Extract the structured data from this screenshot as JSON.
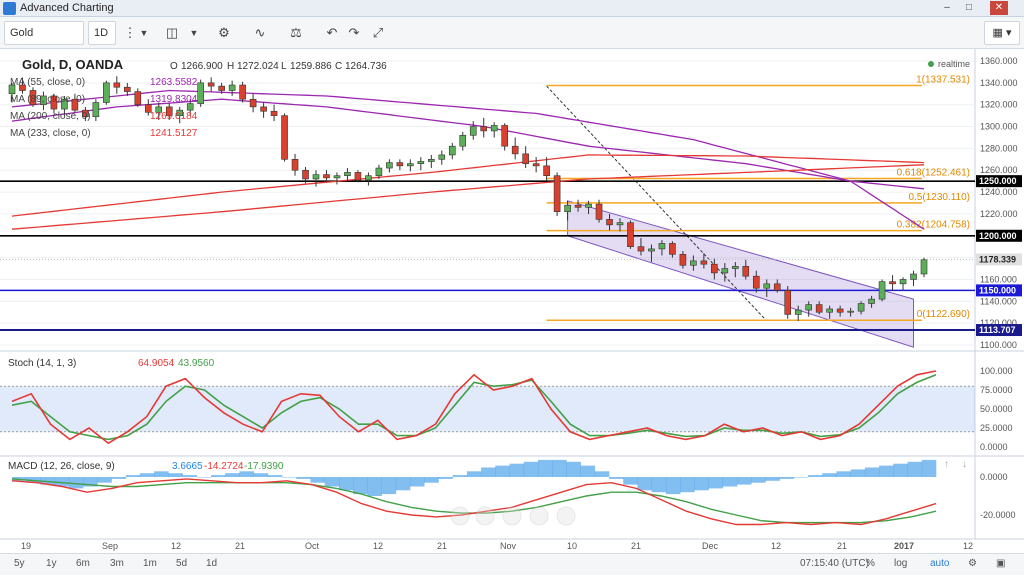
{
  "window": {
    "title": "Advanced Charting"
  },
  "toolbar": {
    "symbol": "Gold",
    "interval": "1D",
    "layout_icon": "grid-layout-icon"
  },
  "legend": {
    "instrument": "Gold, D, OANDA",
    "o_label": "O",
    "o": "1266.900",
    "h_label": "H",
    "h": "1272.024",
    "l_label": "L",
    "l": "1259.886",
    "c_label": "C",
    "c": "1264.736",
    "realtime": "realtime",
    "ma": [
      {
        "label": "MA (55, close, 0)",
        "value": "1263.5582",
        "color": "#9c27b0"
      },
      {
        "label": "MA (89, close, 0)",
        "value": "1319.8304",
        "color": "#9c27b0"
      },
      {
        "label": "MA (200, close, 0)",
        "value": "1269.0184",
        "color": "#e53935"
      },
      {
        "label": "MA (233, close, 0)",
        "value": "1241.5127",
        "color": "#e53935"
      }
    ]
  },
  "stoch_legend": {
    "label": "Stoch (14, 1, 3)",
    "k": "64.9054",
    "d": "43.9560"
  },
  "macd_legend": {
    "label": "MACD (12, 26, close, 9)",
    "hist": "3.6665",
    "macd": "-14.2724",
    "signal": "-17.9390"
  },
  "bottom": {
    "ranges": [
      "5y",
      "1y",
      "6m",
      "3m",
      "1m",
      "5d",
      "1d"
    ],
    "time": "07:15:40 (UTC)",
    "pct": "%",
    "log": "log",
    "auto": "auto"
  },
  "chart_data": {
    "type": "candlestick",
    "title": "Gold, D, OANDA",
    "ylim": [
      1100,
      1370
    ],
    "price_ticks": [
      "1360.000",
      "1340.000",
      "1320.000",
      "1300.000",
      "1280.000",
      "1260.000",
      "1240.000",
      "1220.000",
      "1200.000",
      "1180.000",
      "1160.000",
      "1140.000",
      "1120.000",
      "1100.000"
    ],
    "x_ticks": [
      "19",
      "Sep",
      "12",
      "21",
      "Oct",
      "12",
      "21",
      "Nov",
      "10",
      "21",
      "Dec",
      "12",
      "21",
      "2017",
      "12"
    ],
    "price_flags": [
      {
        "value": 1250.0,
        "label": "1250.000",
        "color": "#000000"
      },
      {
        "value": 1200.0,
        "label": "1200.000",
        "color": "#000000"
      },
      {
        "value": 1178.339,
        "label": "1178.339",
        "color": "#9e9e9e"
      },
      {
        "value": 1150.0,
        "label": "1150.000",
        "color": "#1a1ad6"
      },
      {
        "value": 1113.707,
        "label": "1113.707",
        "color": "#1a1a8c"
      }
    ],
    "fib_levels": [
      {
        "value": 1337.531,
        "label": "1(1337.531)"
      },
      {
        "value": 1252.461,
        "label": "0.618(1252.461)"
      },
      {
        "value": 1230.11,
        "label": "0.5(1230.110)"
      },
      {
        "value": 1204.758,
        "label": "0.382(1204.758)"
      },
      {
        "value": 1122.69,
        "label": "0(1122.690)"
      }
    ],
    "candles": [
      [
        1330,
        1340,
        1322,
        1338
      ],
      [
        1338,
        1345,
        1330,
        1333
      ],
      [
        1333,
        1336,
        1318,
        1320
      ],
      [
        1320,
        1332,
        1315,
        1328
      ],
      [
        1328,
        1330,
        1312,
        1316
      ],
      [
        1316,
        1328,
        1310,
        1325
      ],
      [
        1325,
        1330,
        1313,
        1315
      ],
      [
        1315,
        1318,
        1305,
        1309
      ],
      [
        1309,
        1325,
        1305,
        1322
      ],
      [
        1322,
        1342,
        1320,
        1340
      ],
      [
        1340,
        1346,
        1330,
        1336
      ],
      [
        1336,
        1340,
        1328,
        1332
      ],
      [
        1332,
        1335,
        1318,
        1320
      ],
      [
        1320,
        1325,
        1310,
        1313
      ],
      [
        1313,
        1322,
        1306,
        1318
      ],
      [
        1318,
        1322,
        1306,
        1310
      ],
      [
        1310,
        1318,
        1303,
        1315
      ],
      [
        1315,
        1325,
        1310,
        1321
      ],
      [
        1321,
        1343,
        1318,
        1340
      ],
      [
        1340,
        1345,
        1332,
        1337
      ],
      [
        1337,
        1340,
        1330,
        1333
      ],
      [
        1333,
        1342,
        1328,
        1338
      ],
      [
        1338,
        1341,
        1322,
        1325
      ],
      [
        1325,
        1330,
        1313,
        1318
      ],
      [
        1318,
        1322,
        1308,
        1314
      ],
      [
        1314,
        1320,
        1305,
        1310
      ],
      [
        1310,
        1312,
        1268,
        1270
      ],
      [
        1270,
        1275,
        1255,
        1260
      ],
      [
        1260,
        1263,
        1248,
        1252
      ],
      [
        1252,
        1260,
        1245,
        1256
      ],
      [
        1256,
        1260,
        1250,
        1253
      ],
      [
        1253,
        1258,
        1247,
        1255
      ],
      [
        1255,
        1262,
        1250,
        1258
      ],
      [
        1258,
        1260,
        1249,
        1251
      ],
      [
        1251,
        1258,
        1246,
        1255
      ],
      [
        1255,
        1265,
        1252,
        1262
      ],
      [
        1262,
        1270,
        1258,
        1267
      ],
      [
        1267,
        1270,
        1260,
        1264
      ],
      [
        1264,
        1270,
        1259,
        1266
      ],
      [
        1266,
        1272,
        1260,
        1268
      ],
      [
        1268,
        1274,
        1262,
        1270
      ],
      [
        1270,
        1278,
        1265,
        1274
      ],
      [
        1274,
        1285,
        1270,
        1282
      ],
      [
        1282,
        1295,
        1278,
        1292
      ],
      [
        1292,
        1305,
        1288,
        1300
      ],
      [
        1300,
        1308,
        1290,
        1296
      ],
      [
        1296,
        1304,
        1290,
        1301
      ],
      [
        1301,
        1303,
        1278,
        1282
      ],
      [
        1282,
        1290,
        1270,
        1275
      ],
      [
        1275,
        1282,
        1262,
        1266
      ],
      [
        1266,
        1272,
        1258,
        1264
      ],
      [
        1264,
        1272,
        1250,
        1255
      ],
      [
        1255,
        1258,
        1218,
        1222
      ],
      [
        1222,
        1232,
        1214,
        1228
      ],
      [
        1228,
        1233,
        1222,
        1226
      ],
      [
        1226,
        1232,
        1220,
        1229
      ],
      [
        1229,
        1233,
        1212,
        1215
      ],
      [
        1215,
        1220,
        1205,
        1210
      ],
      [
        1210,
        1216,
        1204,
        1212
      ],
      [
        1212,
        1214,
        1188,
        1190
      ],
      [
        1190,
        1198,
        1182,
        1186
      ],
      [
        1186,
        1192,
        1176,
        1188
      ],
      [
        1188,
        1196,
        1182,
        1193
      ],
      [
        1193,
        1195,
        1180,
        1183
      ],
      [
        1183,
        1186,
        1170,
        1173
      ],
      [
        1173,
        1182,
        1168,
        1177
      ],
      [
        1177,
        1184,
        1170,
        1174
      ],
      [
        1174,
        1179,
        1160,
        1166
      ],
      [
        1166,
        1175,
        1158,
        1170
      ],
      [
        1170,
        1176,
        1162,
        1172
      ],
      [
        1172,
        1178,
        1160,
        1163
      ],
      [
        1163,
        1168,
        1148,
        1152
      ],
      [
        1152,
        1160,
        1144,
        1156
      ],
      [
        1156,
        1160,
        1148,
        1150
      ],
      [
        1150,
        1154,
        1124,
        1128
      ],
      [
        1128,
        1136,
        1122,
        1132
      ],
      [
        1132,
        1140,
        1126,
        1137
      ],
      [
        1137,
        1140,
        1128,
        1130
      ],
      [
        1130,
        1136,
        1124,
        1133
      ],
      [
        1133,
        1136,
        1126,
        1130
      ],
      [
        1130,
        1134,
        1126,
        1131
      ],
      [
        1131,
        1140,
        1128,
        1138
      ],
      [
        1138,
        1145,
        1134,
        1142
      ],
      [
        1142,
        1160,
        1140,
        1158
      ],
      [
        1158,
        1164,
        1150,
        1156
      ],
      [
        1156,
        1162,
        1150,
        1160
      ],
      [
        1160,
        1168,
        1154,
        1165
      ],
      [
        1165,
        1180,
        1162,
        1178
      ]
    ]
  }
}
